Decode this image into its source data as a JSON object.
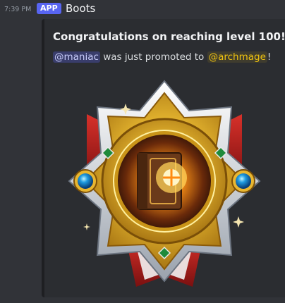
{
  "message": {
    "timestamp": "7:39 PM",
    "app_badge": "APP",
    "author": "Boots"
  },
  "embed": {
    "title": "Congratulations on reaching level 100!",
    "mention_user": "@maniac",
    "text_middle": " was just promoted to ",
    "mention_role": "@archmage",
    "text_end": "!"
  },
  "colors": {
    "background": "#313338",
    "embed_bg": "#2b2d31",
    "app_badge": "#5865f2",
    "role_mention": "#f1c40f"
  },
  "image": {
    "icon": "level-badge-icon"
  }
}
